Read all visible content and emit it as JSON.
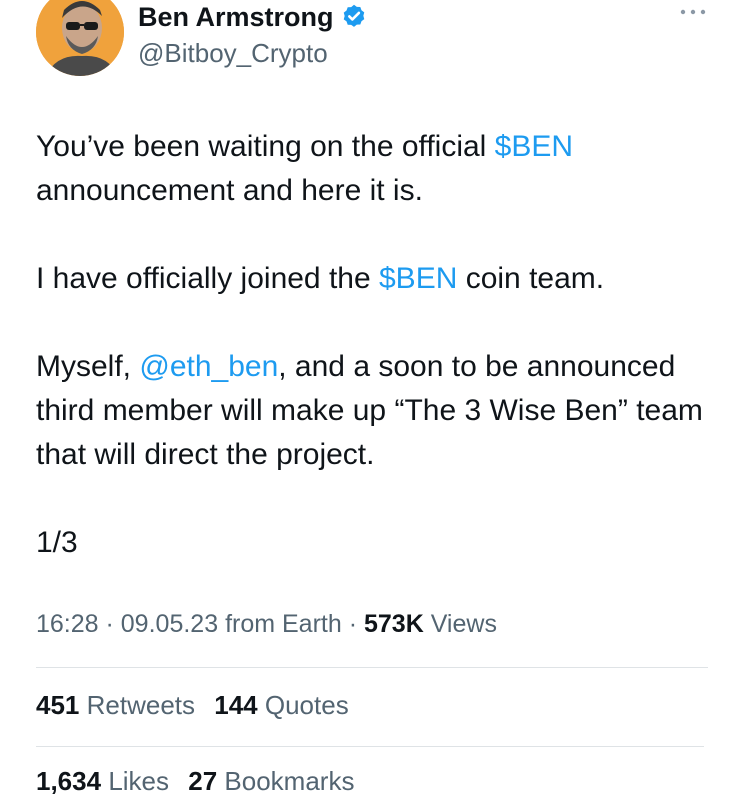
{
  "author": {
    "name": "Ben Armstrong",
    "handle": "@Bitboy_Crypto",
    "avatar_bg": "#f0a23c",
    "verified_icon": "verified-badge-icon",
    "verified_color": "#1d9bf0"
  },
  "more_icon": "more-options-icon",
  "tweet": {
    "p1_a": "You’ve been waiting on the official ",
    "p1_link": "$BEN",
    "p1_b": " announcement and here it is.",
    "p2_a": "I have officially joined the ",
    "p2_link": "$BEN",
    "p2_b": " coin team.",
    "p3_a": "Myself, ",
    "p3_link": "@eth_ben",
    "p3_b": ", and a soon to be announced third member will make up “The 3 Wise Ben” team that will direct the project.",
    "p4": "1/3"
  },
  "meta": {
    "time": "16:28",
    "date": "09.05.23",
    "source": "from Earth",
    "views_count": "573K",
    "views_label": "Views",
    "sep": " · "
  },
  "stats": {
    "retweets_count": "451",
    "retweets_label": "Retweets",
    "quotes_count": "144",
    "quotes_label": "Quotes",
    "likes_count": "1,634",
    "likes_label": "Likes",
    "bookmarks_count": "27",
    "bookmarks_label": "Bookmarks"
  },
  "colors": {
    "link": "#1d9bf0",
    "muted": "#536471",
    "text": "#0f1419"
  }
}
